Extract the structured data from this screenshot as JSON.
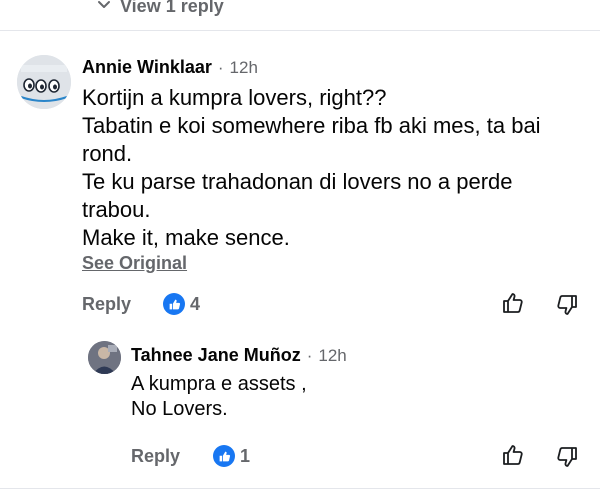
{
  "thread": {
    "view_replies_label": "View 1 reply"
  },
  "comment": {
    "author": "Annie Winklaar",
    "separator": "·",
    "time": "12h",
    "text": "Kortijn a kumpra lovers, right??\nTabatin e koi somewhere riba fb aki mes, ta bai rond.\nTe ku parse trahadonan di lovers no a perde trabou.\nMake it, make sence.",
    "see_original_label": "See Original",
    "reply_label": "Reply",
    "like_count": "4"
  },
  "reply": {
    "author": "Tahnee Jane Muñoz",
    "separator": "·",
    "time": "12h",
    "text": "A kumpra e assets ,\nNo Lovers.",
    "reply_label": "Reply",
    "like_count": "1"
  },
  "colors": {
    "like_blue": "#1877f2",
    "muted_text": "#65676b",
    "primary_text": "#050505"
  }
}
